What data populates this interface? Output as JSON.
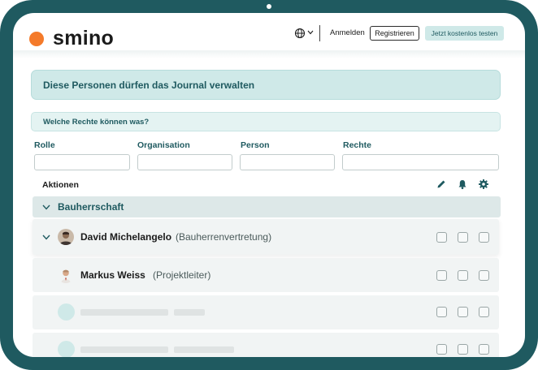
{
  "brand": {
    "name": "smino",
    "accent": "#f47a2a",
    "primary": "#1f5a60",
    "light_teal": "#cfe9e8"
  },
  "header": {
    "language_icon": "globe-icon",
    "login_label": "Anmelden",
    "register_label": "Registrieren",
    "trial_label": "Jetzt kostenlos testen"
  },
  "banner": {
    "title": "Diese Personen dürfen das Journal verwalten"
  },
  "rights_question": "Welche Rechte können was?",
  "filters": {
    "role_label": "Rolle",
    "role_value": "",
    "organisation_label": "Organisation",
    "organisation_value": "",
    "person_label": "Person",
    "person_value": "",
    "rights_label": "Rechte",
    "rights_value": ""
  },
  "actions": {
    "label": "Aktionen",
    "icons": [
      "pencil-icon",
      "bell-icon",
      "gear-icon"
    ]
  },
  "group": {
    "name": "Bauherrschaft",
    "expanded": true
  },
  "people": [
    {
      "name": "David Michelangelo",
      "role": "(Bauherrenvertretung)",
      "expanded": true,
      "rights": [
        false,
        false,
        false
      ]
    },
    {
      "name": "Markus Weiss",
      "role": "(Projektleiter)",
      "expanded": false,
      "rights": [
        false,
        false,
        false
      ]
    }
  ],
  "placeholder_rows": 2
}
